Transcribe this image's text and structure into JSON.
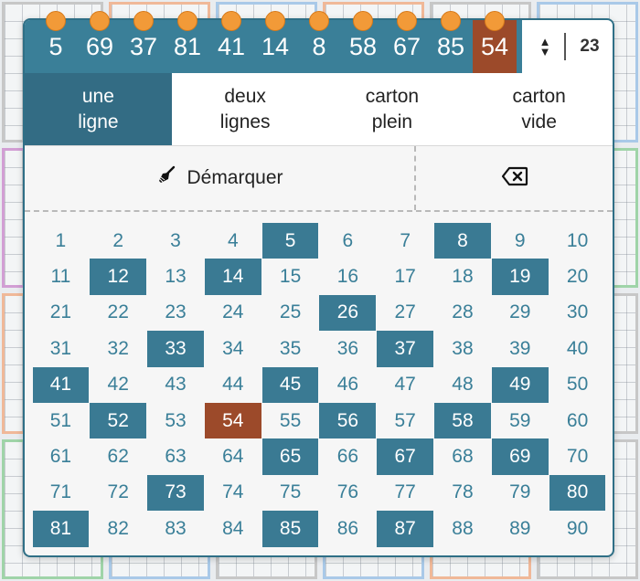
{
  "drawn": {
    "numbers": [
      "5",
      "69",
      "37",
      "81",
      "41",
      "14",
      "8",
      "58",
      "67",
      "85",
      "54"
    ],
    "last": "54",
    "count": "23"
  },
  "tabs": [
    {
      "label": "une\nligne",
      "active": true
    },
    {
      "label": "deux\nlignes",
      "active": false
    },
    {
      "label": "carton\nplein",
      "active": false
    },
    {
      "label": "carton\nvide",
      "active": false
    }
  ],
  "actions": {
    "unmark_label": "Démarquer"
  },
  "board": {
    "numbers": [
      "1",
      "2",
      "3",
      "4",
      "5",
      "6",
      "7",
      "8",
      "9",
      "10",
      "11",
      "12",
      "13",
      "14",
      "15",
      "16",
      "17",
      "18",
      "19",
      "20",
      "21",
      "22",
      "23",
      "24",
      "25",
      "26",
      "27",
      "28",
      "29",
      "30",
      "31",
      "32",
      "33",
      "34",
      "35",
      "36",
      "37",
      "38",
      "39",
      "40",
      "41",
      "42",
      "43",
      "44",
      "45",
      "46",
      "47",
      "48",
      "49",
      "50",
      "51",
      "52",
      "53",
      "54",
      "55",
      "56",
      "57",
      "58",
      "59",
      "60",
      "61",
      "62",
      "63",
      "64",
      "65",
      "66",
      "67",
      "68",
      "69",
      "70",
      "71",
      "72",
      "73",
      "74",
      "75",
      "76",
      "77",
      "78",
      "79",
      "80",
      "81",
      "82",
      "83",
      "84",
      "85",
      "86",
      "87",
      "88",
      "89",
      "90"
    ],
    "marked": [
      5,
      8,
      12,
      14,
      19,
      26,
      33,
      37,
      41,
      45,
      49,
      52,
      54,
      56,
      58,
      65,
      67,
      69,
      73,
      80,
      81,
      85,
      87
    ],
    "last": 54
  },
  "colors": {
    "accent": "#3a7f98",
    "marked": "#3a7a93",
    "last": "#9c4a2a",
    "pin": "#f29a38"
  }
}
